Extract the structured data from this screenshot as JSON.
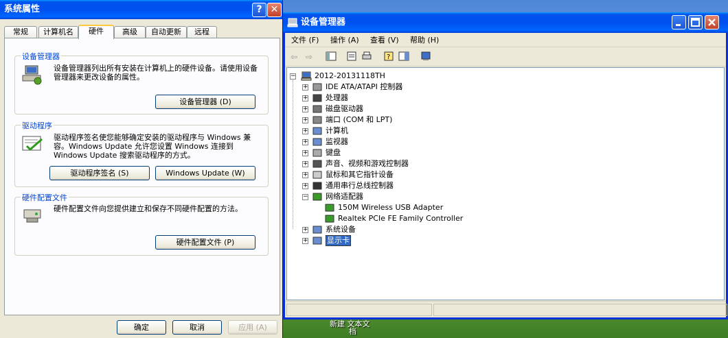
{
  "system_properties": {
    "title": "系统属性",
    "help_button": "?",
    "close_button": "✕",
    "tabs": [
      {
        "label": "常规"
      },
      {
        "label": "计算机名"
      },
      {
        "label": "硬件",
        "active": true
      },
      {
        "label": "高级"
      },
      {
        "label": "自动更新"
      },
      {
        "label": "远程"
      }
    ],
    "device_manager_group": {
      "title": "设备管理器",
      "text": "设备管理器列出所有安装在计算机上的硬件设备。请使用设备管理器来更改设备的属性。",
      "button": "设备管理器 (D)",
      "icon": "device-manager-icon"
    },
    "drivers_group": {
      "title": "驱动程序",
      "text": "驱动程序签名使您能够确定安装的驱动程序与 Windows 兼容。Windows Update 允许您设置 Windows 连接到 Windows Update 搜索驱动程序的方式。",
      "button_signing": "驱动程序签名 (S)",
      "button_update": "Windows Update (W)",
      "icon": "driver-signing-icon"
    },
    "hardware_profiles_group": {
      "title": "硬件配置文件",
      "text": "硬件配置文件向您提供建立和保存不同硬件配置的方法。",
      "button": "硬件配置文件 (P)",
      "icon": "hardware-profiles-icon"
    },
    "footer": {
      "ok": "确定",
      "cancel": "取消",
      "apply": "应用 (A)"
    }
  },
  "device_manager": {
    "title": "设备管理器",
    "menu": [
      "文件 (F)",
      "操作 (A)",
      "查看 (V)",
      "帮助 (H)"
    ],
    "toolbar_icons": [
      "back-icon",
      "forward-icon",
      "console-tree-icon",
      "properties-icon",
      "print-icon",
      "help-icon",
      "show-pane-icon",
      "scan-hardware-icon"
    ],
    "tree": {
      "root": "2012-20131118TH",
      "nodes": [
        {
          "label": "IDE ATA/ATAPI 控制器",
          "icon": "ide-controller-icon",
          "expanded": false
        },
        {
          "label": "处理器",
          "icon": "processor-icon",
          "expanded": false
        },
        {
          "label": "磁盘驱动器",
          "icon": "disk-drive-icon",
          "expanded": false
        },
        {
          "label": "端口 (COM 和 LPT)",
          "icon": "port-icon",
          "expanded": false
        },
        {
          "label": "计算机",
          "icon": "computer-icon",
          "expanded": false
        },
        {
          "label": "监视器",
          "icon": "monitor-icon",
          "expanded": false
        },
        {
          "label": "键盘",
          "icon": "keyboard-icon",
          "expanded": false
        },
        {
          "label": "声音、视频和游戏控制器",
          "icon": "sound-icon",
          "expanded": false
        },
        {
          "label": "鼠标和其它指针设备",
          "icon": "mouse-icon",
          "expanded": false
        },
        {
          "label": "通用串行总线控制器",
          "icon": "usb-icon",
          "expanded": false
        },
        {
          "label": "网络适配器",
          "icon": "network-adapter-icon",
          "expanded": true,
          "children": [
            {
              "label": "150M Wireless USB Adapter",
              "icon": "network-card-icon"
            },
            {
              "label": "Realtek PCIe FE Family Controller",
              "icon": "network-card-icon"
            }
          ]
        },
        {
          "label": "系统设备",
          "icon": "system-device-icon",
          "expanded": false
        },
        {
          "label": "显示卡",
          "icon": "display-adapter-icon",
          "expanded": false,
          "selected": true
        }
      ]
    }
  },
  "desktop": {
    "label_line1": "新建 文本文",
    "label_line2": "档"
  }
}
